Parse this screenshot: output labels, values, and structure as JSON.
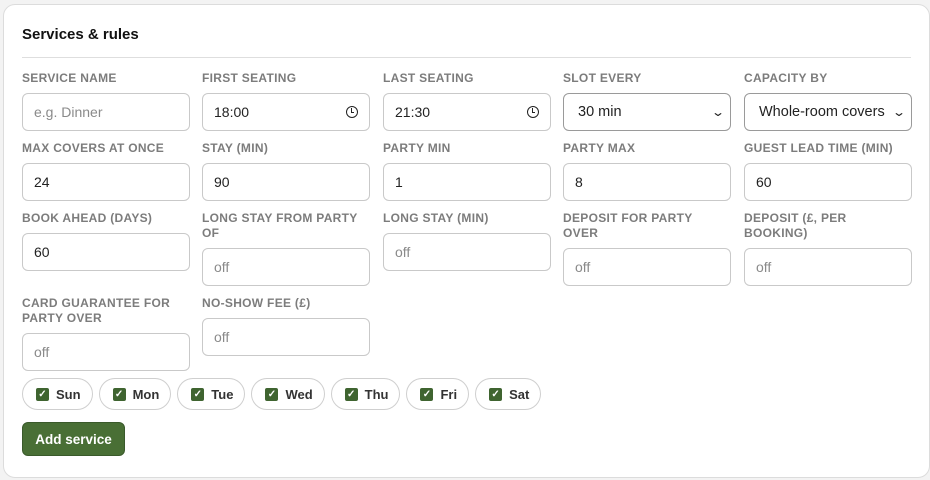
{
  "card": {
    "title": "Services & rules"
  },
  "fields": {
    "service_name": {
      "label": "SERVICE NAME",
      "placeholder": "e.g. Dinner",
      "value": ""
    },
    "first_seating": {
      "label": "FIRST SEATING",
      "value": "18:00"
    },
    "last_seating": {
      "label": "LAST SEATING",
      "value": "21:30"
    },
    "slot_every": {
      "label": "SLOT EVERY",
      "value": "30 min"
    },
    "capacity_by": {
      "label": "CAPACITY BY",
      "value": "Whole-room covers"
    },
    "max_covers": {
      "label": "MAX COVERS AT ONCE",
      "value": "24"
    },
    "stay": {
      "label": "STAY (MIN)",
      "value": "90"
    },
    "party_min": {
      "label": "PARTY MIN",
      "value": "1"
    },
    "party_max": {
      "label": "PARTY MAX",
      "value": "8"
    },
    "lead_time": {
      "label": "GUEST LEAD TIME (MIN)",
      "value": "60"
    },
    "book_ahead": {
      "label": "BOOK AHEAD (DAYS)",
      "value": "60"
    },
    "long_stay_party": {
      "label": "LONG STAY FROM PARTY OF",
      "placeholder": "off",
      "value": ""
    },
    "long_stay_min": {
      "label": "LONG STAY (MIN)",
      "placeholder": "off",
      "value": ""
    },
    "deposit_party": {
      "label": "DEPOSIT FOR PARTY OVER",
      "placeholder": "off",
      "value": ""
    },
    "deposit_amount": {
      "label": "DEPOSIT (£, PER BOOKING)",
      "placeholder": "off",
      "value": ""
    },
    "card_guarantee": {
      "label": "CARD GUARANTEE FOR PARTY OVER",
      "placeholder": "off",
      "value": ""
    },
    "no_show_fee": {
      "label": "NO-SHOW FEE (£)",
      "placeholder": "off",
      "value": ""
    }
  },
  "days": [
    {
      "label": "Sun",
      "checked": true
    },
    {
      "label": "Mon",
      "checked": true
    },
    {
      "label": "Tue",
      "checked": true
    },
    {
      "label": "Wed",
      "checked": true
    },
    {
      "label": "Thu",
      "checked": true
    },
    {
      "label": "Fri",
      "checked": true
    },
    {
      "label": "Sat",
      "checked": true
    }
  ],
  "actions": {
    "add_label": "Add service"
  },
  "colors": {
    "accent": "#496f35"
  }
}
